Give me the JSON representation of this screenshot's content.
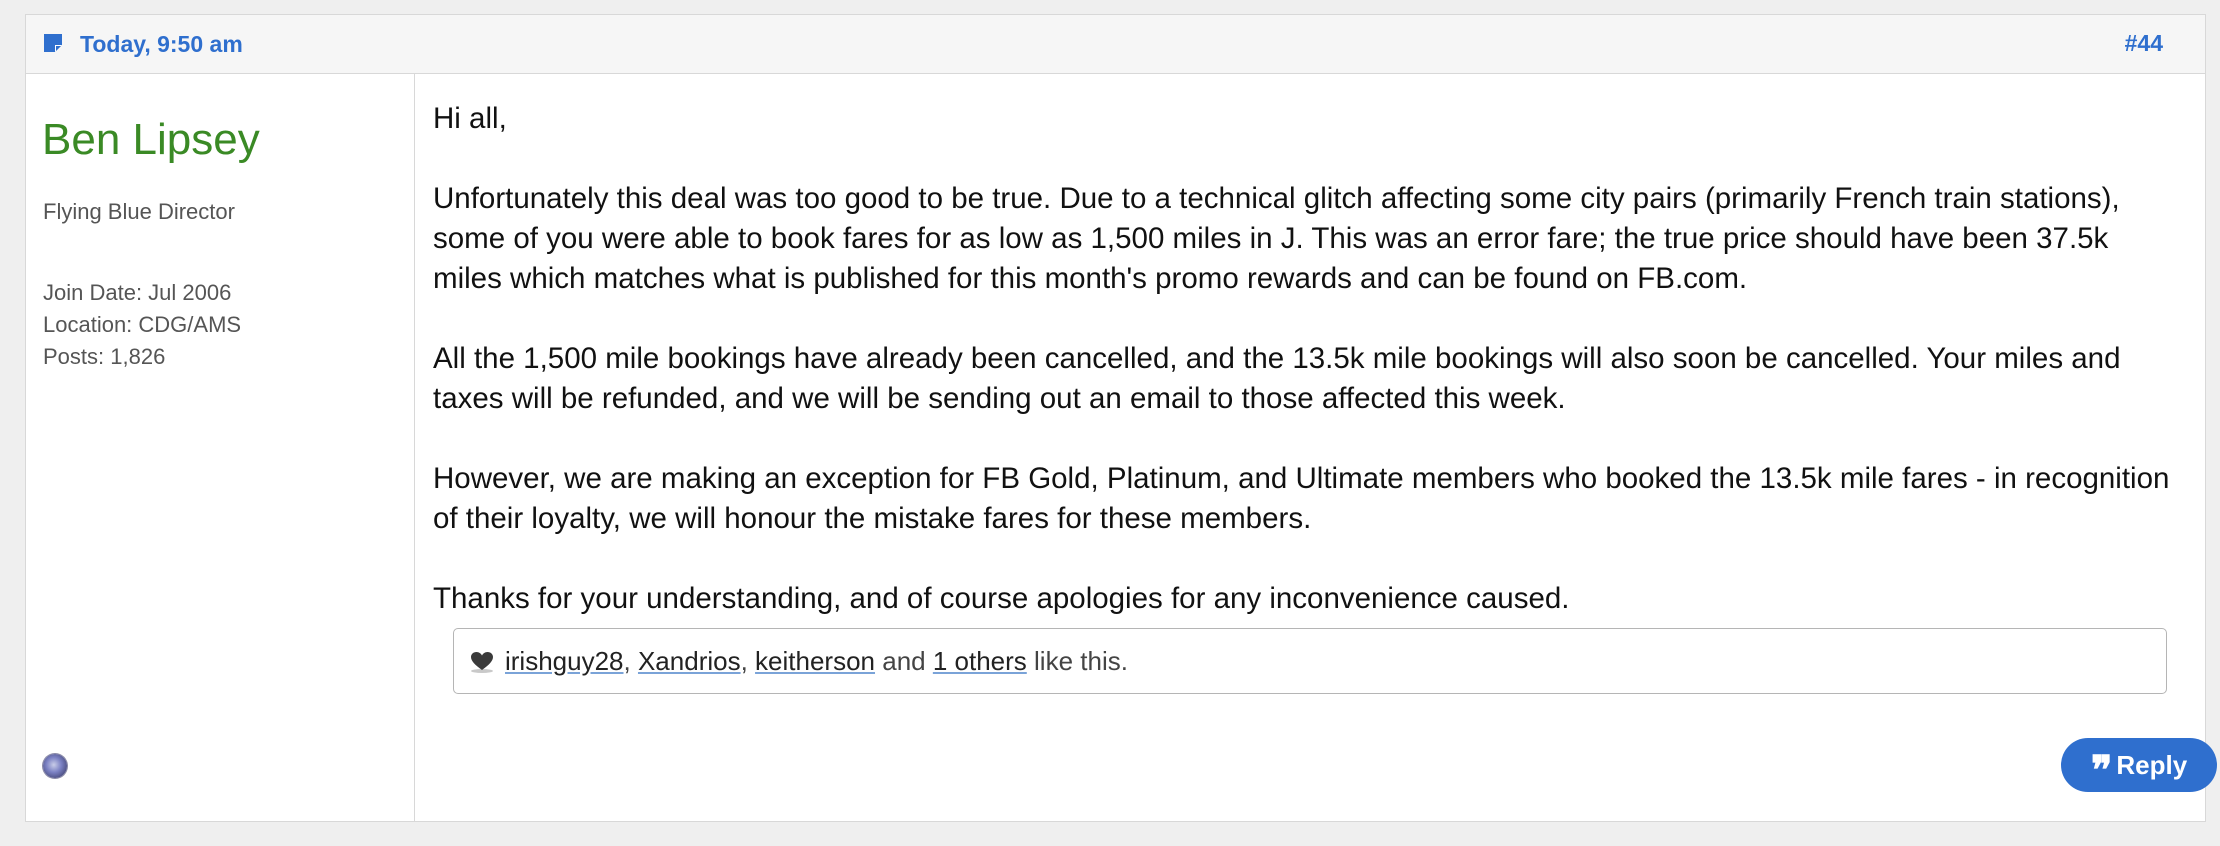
{
  "post": {
    "date": "Today, 9:50 am",
    "number": "#44",
    "accent_color": "#2f6fce"
  },
  "user": {
    "name": "Ben Lipsey",
    "name_color": "#3a8a25",
    "title": "Flying Blue Director",
    "join_date": "Join Date: Jul 2006",
    "location": "Location: CDG/AMS",
    "posts": "Posts: 1,826",
    "status_icon": "online-status-icon"
  },
  "message": {
    "paragraphs": [
      "Hi all,",
      "Unfortunately this deal was too good to be true. Due to a technical glitch affecting some city pairs (primarily French train stations), some of you were able to book fares for as low as 1,500 miles in J. This was an error fare; the true price should have been 37.5k miles which matches what is published for this month's promo rewards and can be found on FB.com.",
      "All the 1,500 mile bookings have already been cancelled, and the 13.5k mile bookings will also soon be cancelled. Your miles and taxes will be refunded, and we will be sending out an email to those affected this week.",
      "However, we are making an exception for FB Gold, Platinum, and Ultimate members who booked the 13.5k mile fares - in recognition of their loyalty, we will honour the mistake fares for these members.",
      "Thanks for your understanding, and of course apologies for any inconvenience caused."
    ]
  },
  "likes": {
    "users": [
      "irishguy28",
      "Xandrios",
      "keitherson"
    ],
    "sep1": ", ",
    "sep2": ", ",
    "and_text": " and ",
    "others_link": "1 others",
    "suffix": " like this."
  },
  "actions": {
    "reply_label": "Reply",
    "reply_icon": "quote-icon"
  }
}
